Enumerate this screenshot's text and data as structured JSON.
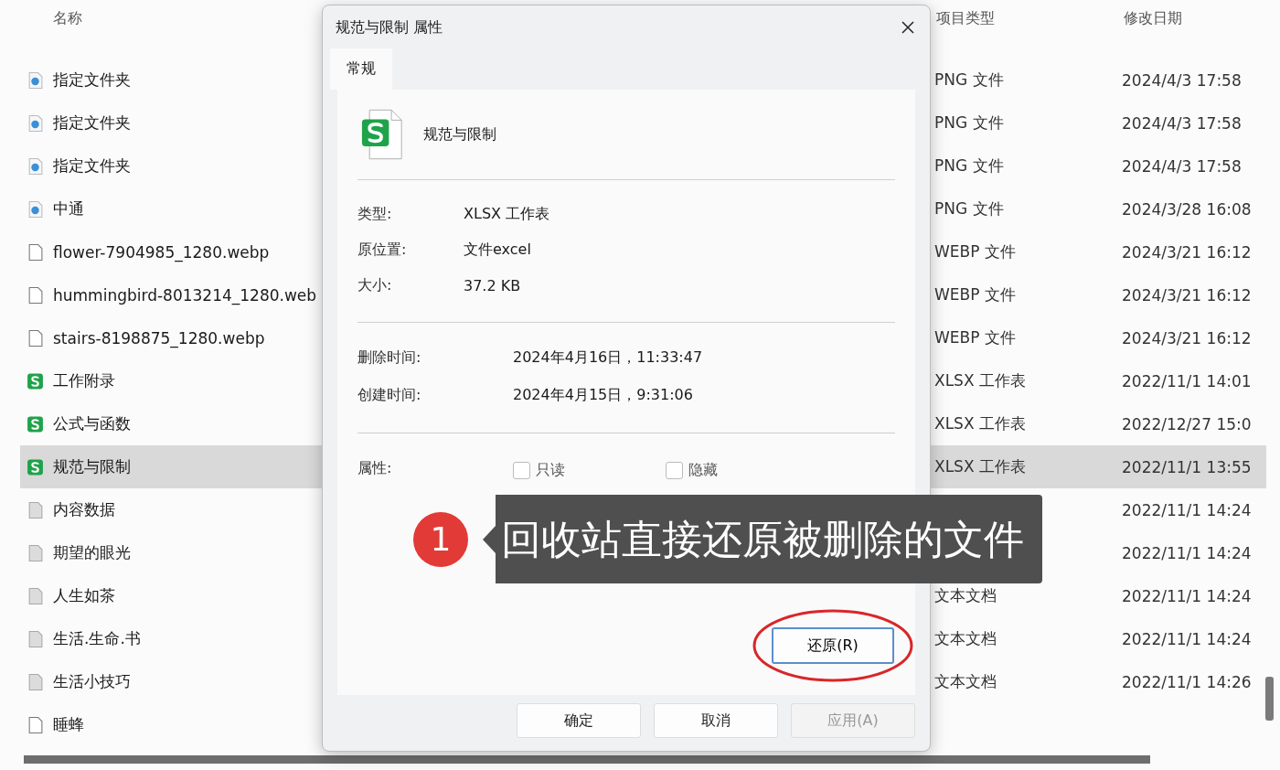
{
  "explorer": {
    "columns": [
      "名称",
      "项目类型",
      "修改日期"
    ],
    "rows": [
      {
        "name": "指定文件夹",
        "kind": "image",
        "type": "PNG 文件",
        "modified": "2024/4/3 17:58",
        "selected": false
      },
      {
        "name": "指定文件夹",
        "kind": "image",
        "type": "PNG 文件",
        "modified": "2024/4/3 17:58",
        "selected": false
      },
      {
        "name": "指定文件夹",
        "kind": "image",
        "type": "PNG 文件",
        "modified": "2024/4/3 17:58",
        "selected": false
      },
      {
        "name": "中通",
        "kind": "image",
        "type": "PNG 文件",
        "modified": "2024/3/28 16:08",
        "selected": false
      },
      {
        "name": "flower-7904985_1280.webp",
        "kind": "blank",
        "type": "WEBP 文件",
        "modified": "2024/3/21 16:12",
        "selected": false
      },
      {
        "name": "hummingbird-8013214_1280.web",
        "kind": "blank",
        "type": "WEBP 文件",
        "modified": "2024/3/21 16:12",
        "selected": false
      },
      {
        "name": "stairs-8198875_1280.webp",
        "kind": "blank",
        "type": "WEBP 文件",
        "modified": "2024/3/21 16:12",
        "selected": false
      },
      {
        "name": "工作附录",
        "kind": "sheet",
        "type": "XLSX 工作表",
        "modified": "2022/11/1 14:01",
        "selected": false
      },
      {
        "name": "公式与函数",
        "kind": "sheet",
        "type": "XLSX 工作表",
        "modified": "2022/12/27 15:0",
        "selected": false
      },
      {
        "name": "规范与限制",
        "kind": "sheet",
        "type": "XLSX 工作表",
        "modified": "2022/11/1 13:55",
        "selected": true
      },
      {
        "name": "内容数据",
        "kind": "text",
        "modified": "2022/11/1 14:24",
        "selected": false
      },
      {
        "name": "期望的眼光",
        "kind": "text",
        "modified": "2022/11/1 14:24",
        "selected": false
      },
      {
        "name": "人生如茶",
        "kind": "text",
        "type": "文本文档",
        "modified": "2022/11/1 14:24",
        "selected": false
      },
      {
        "name": "生活.生命.书",
        "kind": "text",
        "type": "文本文档",
        "modified": "2022/11/1 14:24",
        "selected": false
      },
      {
        "name": "生活小技巧",
        "kind": "text",
        "type": "文本文档",
        "modified": "2022/11/1 14:26",
        "selected": false
      },
      {
        "name": "睡蜂",
        "kind": "blank",
        "selected": false
      }
    ]
  },
  "dialog": {
    "title": "规范与限制 属性",
    "tabs": [
      {
        "label": "常规",
        "selected": true
      }
    ],
    "file_name": "规范与限制",
    "info": [
      {
        "label": "类型:",
        "value": "XLSX 工作表"
      },
      {
        "label": "原位置:",
        "value": "文件excel"
      },
      {
        "label": "大小:",
        "value": "37.2 KB"
      }
    ],
    "times": [
      {
        "label": "删除时间:",
        "value": "2024年4月16日，11:33:47"
      },
      {
        "label": "创建时间:",
        "value": "2024年4月15日，9:31:06"
      }
    ],
    "attributes_label": "属性:",
    "attributes": [
      {
        "label": "只读",
        "checked": false
      },
      {
        "label": "隐藏",
        "checked": false
      }
    ],
    "restore_button": {
      "label": "还原(R)",
      "highlighted": true
    },
    "buttons": [
      {
        "label": "确定",
        "disabled": false
      },
      {
        "label": "取消",
        "disabled": false
      },
      {
        "label": "应用(A)",
        "disabled": true
      }
    ]
  },
  "callout": {
    "number": "1",
    "text": "回收站直接还原被删除的文件"
  }
}
